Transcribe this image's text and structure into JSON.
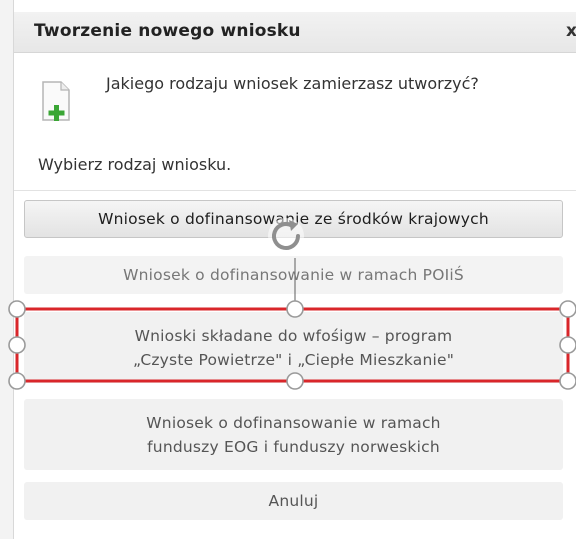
{
  "dialog": {
    "title": "Tworzenie nowego wniosku",
    "close_label": "x",
    "question": "Jakiego rodzaju wniosek zamierzasz utworzyć?",
    "instruction": "Wybierz rodzaj wniosku."
  },
  "options": [
    {
      "lines": [
        "Wniosek o dofinansowanie ze środków krajowych"
      ]
    },
    {
      "lines": [
        "Wniosek o dofinansowanie w ramach POIiŚ"
      ]
    },
    {
      "lines": [
        "Wnioski składane do wfośigw – program",
        "„Czyste Powietrze\" i „Ciepłe Mieszkanie\""
      ]
    },
    {
      "lines": [
        "Wniosek o dofinansowanie w ramach",
        "funduszy EOG i funduszy norweskich"
      ]
    }
  ],
  "cancel_label": "Anuluj",
  "icons": {
    "document": "new-document-icon",
    "add": "plus-icon",
    "rotate": "rotate-handle-icon"
  },
  "colors": {
    "selection": "#d9262a",
    "add_icon": "#3aa635"
  }
}
